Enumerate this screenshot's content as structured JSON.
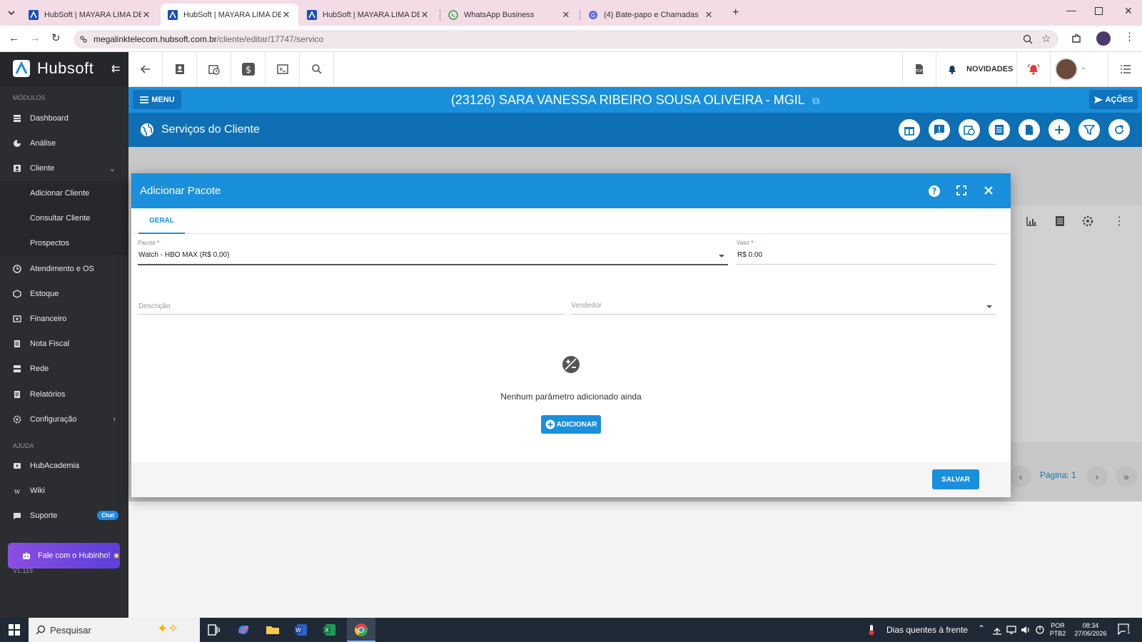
{
  "browser": {
    "tabs": [
      {
        "title": "HubSoft | MAYARA LIMA DE OL",
        "active": false
      },
      {
        "title": "HubSoft | MAYARA LIMA DE OL",
        "active": true
      },
      {
        "title": "HubSoft | MAYARA LIMA DE OL",
        "active": false
      },
      {
        "title": "WhatsApp Business",
        "active": false
      },
      {
        "title": "(4) Bate-papo e Chamadas",
        "active": false
      }
    ],
    "url_host": "megalinktelecom.hubsoft.com.br",
    "url_path": "/cliente/editar/17747/servico"
  },
  "sidebar": {
    "logo_text": "Hubsoft",
    "section_modules": "MÓDULOS",
    "items": [
      {
        "label": "Dashboard",
        "icon": "dashboard-icon"
      },
      {
        "label": "Análise",
        "icon": "chart-pie-icon"
      },
      {
        "label": "Cliente",
        "icon": "contact-icon"
      },
      {
        "label": "Adicionar Cliente",
        "icon": ""
      },
      {
        "label": "Consultar Cliente",
        "icon": ""
      },
      {
        "label": "Prospectos",
        "icon": ""
      },
      {
        "label": "Atendimento e OS",
        "icon": "clock-icon"
      },
      {
        "label": "Estoque",
        "icon": "box-icon"
      },
      {
        "label": "Financeiro",
        "icon": "money-icon"
      },
      {
        "label": "Nota Fiscal",
        "icon": "receipt-icon"
      },
      {
        "label": "Rede",
        "icon": "server-icon"
      },
      {
        "label": "Relatórios",
        "icon": "report-icon"
      },
      {
        "label": "Configuração",
        "icon": "gear-icon"
      }
    ],
    "section_help": "AJUDA",
    "help_items": [
      {
        "label": "HubAcademia",
        "icon": "play-icon"
      },
      {
        "label": "Wiki",
        "icon": "wiki-icon"
      },
      {
        "label": "Suporte",
        "icon": "chat-icon"
      }
    ],
    "chat_badge": "Chat",
    "hubinho_label": "Fale com o Hubinho!",
    "version": "V1.119"
  },
  "toolbar": {
    "novidades": "NOVIDADES"
  },
  "header": {
    "menu_label": "MENU",
    "client_title": "(23126) SARA VANESSA RIBEIRO SOUSA OLIVEIRA - MGIL",
    "acoes_label": "AÇÕES",
    "section_title": "Serviços do Cliente"
  },
  "pager": {
    "page_label": "Página: 1"
  },
  "modal": {
    "title": "Adicionar Pacote",
    "tab_label": "GERAL",
    "pacote_label": "Pacote",
    "pacote_value": "Watch - HBO MAX (R$ 0,00)",
    "valor_label": "Valor",
    "valor_value": "R$ 0.00",
    "descricao_placeholder": "Descrição",
    "vendedor_placeholder": "Vendedor",
    "empty_message": "Nenhum parâmetro adicionado ainda",
    "add_label": "ADICIONAR",
    "save_label": "SALVAR"
  },
  "taskbar": {
    "search_placeholder": "Pesquisar",
    "weather": "Dias quentes à frente",
    "lang_top": "POR",
    "lang_bottom": "PTB2",
    "time": "08:34",
    "date": "27/06/2026",
    "notif_count": "1"
  },
  "colors": {
    "primary": "#1a8fdc",
    "dark_blue": "#0f6fb5",
    "sidebar": "#2b2d31",
    "danger": "#e53935"
  }
}
